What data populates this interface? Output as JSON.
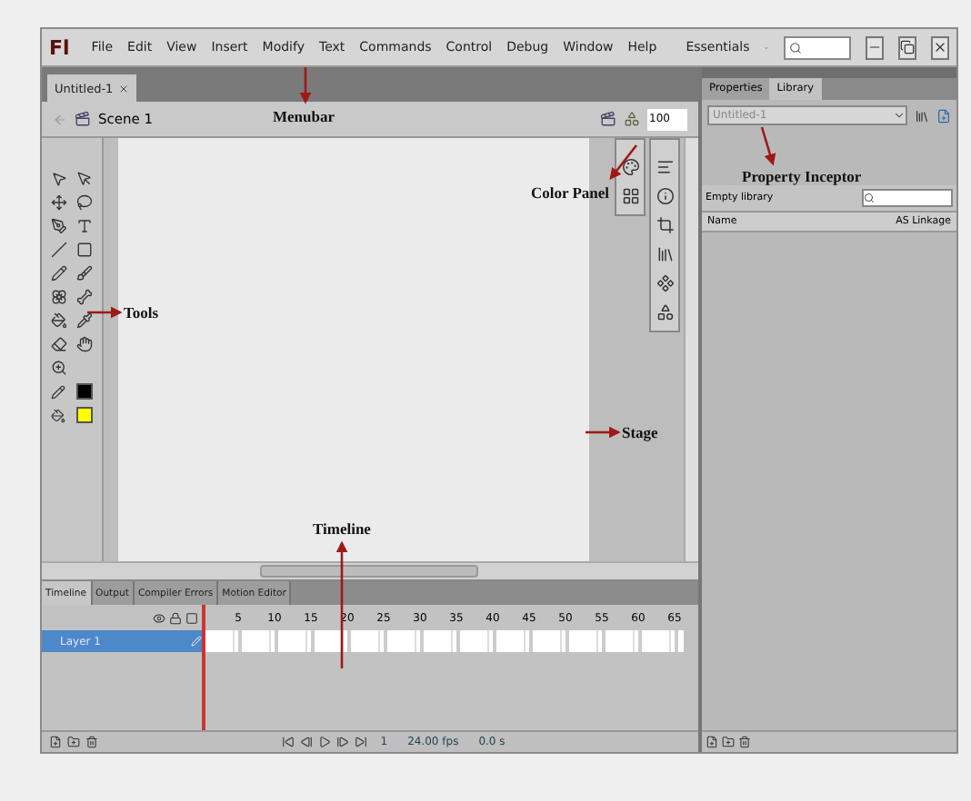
{
  "app": {
    "logo": "Fl",
    "menus": [
      "File",
      "Edit",
      "View",
      "Insert",
      "Modify",
      "Text",
      "Commands",
      "Control",
      "Debug",
      "Window",
      "Help"
    ],
    "workspace": "Essentials"
  },
  "document_tabs": [
    {
      "label": "Untitled-1",
      "selected": true
    }
  ],
  "scene": {
    "label": "Scene 1",
    "zoom": "100"
  },
  "right_panel": {
    "tabs": [
      {
        "label": "Properties",
        "selected": false
      },
      {
        "label": "Library",
        "selected": true
      }
    ],
    "document_select": "Untitled-1",
    "library_status": "Empty library",
    "columns": [
      "Name",
      "AS Linkage"
    ]
  },
  "timeline": {
    "tabs": [
      {
        "label": "Timeline",
        "selected": true
      },
      {
        "label": "Output",
        "selected": false
      },
      {
        "label": "Compiler Errors",
        "selected": false
      },
      {
        "label": "Motion Editor",
        "selected": false
      }
    ],
    "frame_numbers": [
      "5",
      "10",
      "15",
      "20",
      "25",
      "30",
      "35",
      "40",
      "45",
      "50",
      "55",
      "60",
      "65"
    ],
    "layers": [
      {
        "name": "Layer 1",
        "selected": true
      }
    ],
    "current_frame": "1",
    "fps": "24.00 fps",
    "time": "0.0 s"
  },
  "annotations": [
    {
      "label": "Menubar"
    },
    {
      "label": "Color Panel"
    },
    {
      "label": "Property Inceptor"
    },
    {
      "label": "Tools"
    },
    {
      "label": "Stage"
    },
    {
      "label": "Timeline"
    }
  ]
}
